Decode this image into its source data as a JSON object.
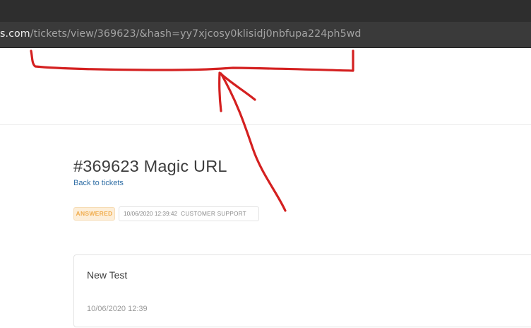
{
  "browser": {
    "url_host": "s.com",
    "url_path": "/tickets/view/369623/&hash=yy7xjcosy0klisidj0nbfupa224ph5wd"
  },
  "ticket": {
    "title": "#369623 Magic URL",
    "back_link": "Back to tickets",
    "status": "ANSWERED",
    "created": "10/06/2020 12:39:42",
    "department": "CUSTOMER SUPPORT"
  },
  "message": {
    "body": "New Test",
    "date": "10/06/2020 12:39"
  },
  "colors": {
    "annotation": "#d42020",
    "status": "#f0ad4e",
    "link": "#2e6da4"
  }
}
